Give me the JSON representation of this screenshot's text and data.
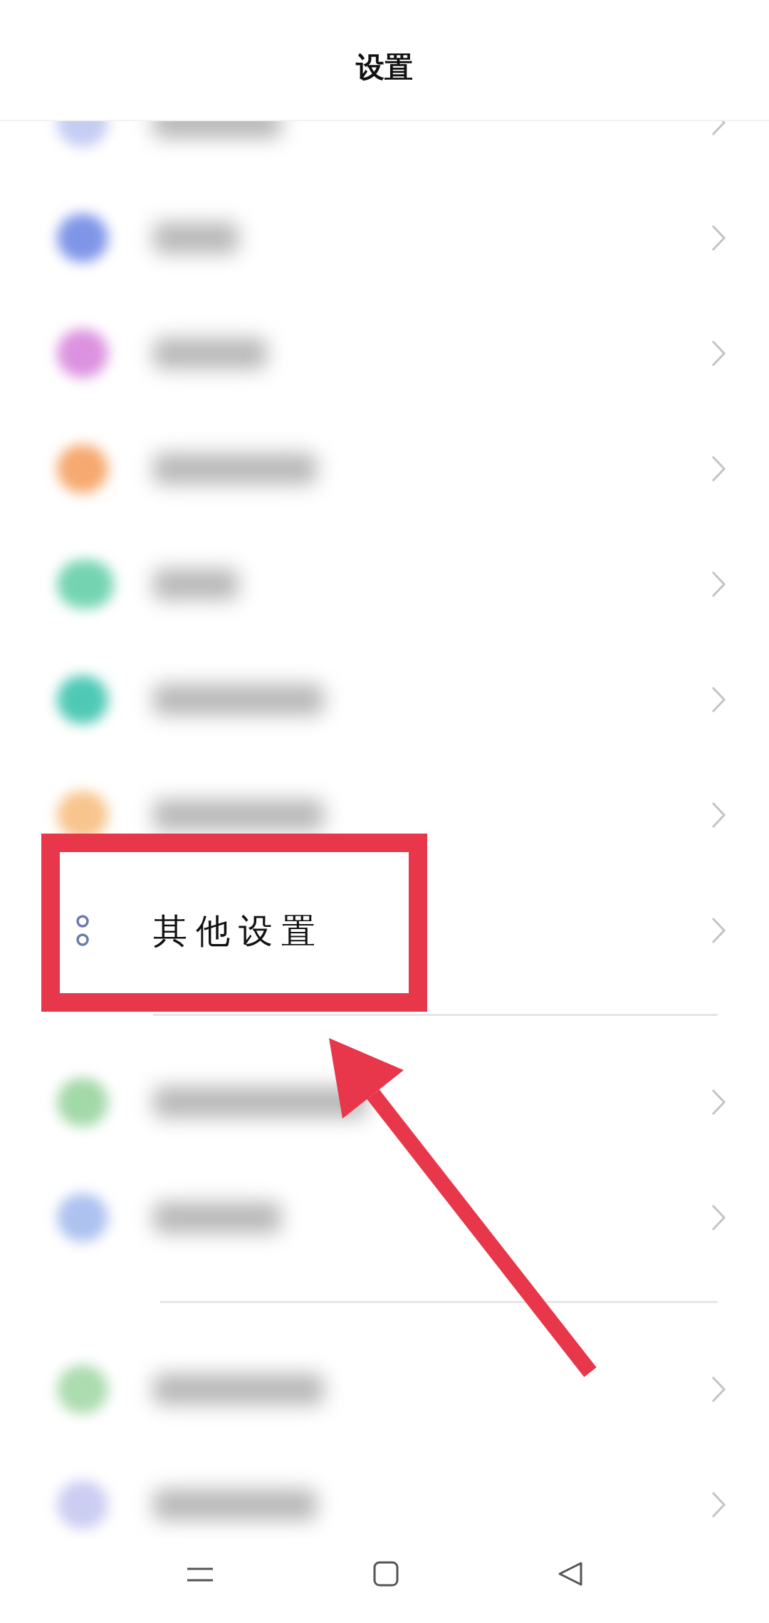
{
  "header": {
    "title": "设置"
  },
  "groups": [
    {
      "rows": [
        {
          "kind": "blurred",
          "color": "#c5cdf3",
          "partial": true
        },
        {
          "kind": "blurred",
          "color": "#7f96e8",
          "partial": false
        },
        {
          "kind": "blurred",
          "color": "#dc92e0",
          "partial": false
        },
        {
          "kind": "blurred",
          "color": "#f6a970",
          "partial": false
        },
        {
          "kind": "blurred",
          "color": "#74d4b2",
          "partial": false
        },
        {
          "kind": "blurred",
          "color": "#4fc9b6",
          "partial": false
        },
        {
          "kind": "blurred",
          "color": "#f8c58e",
          "partial": false
        },
        {
          "kind": "item",
          "label": "其他设置",
          "highlighted": true
        }
      ]
    },
    {
      "rows": [
        {
          "kind": "blurred",
          "color": "#a3d8a8",
          "partial": false
        },
        {
          "kind": "blurred",
          "color": "#aec2f0",
          "partial": false
        }
      ]
    },
    {
      "rows": [
        {
          "kind": "blurred",
          "color": "#acdcb0",
          "partial": false
        },
        {
          "kind": "blurred",
          "color": "#cccdf2",
          "partial": false
        }
      ]
    }
  ]
}
